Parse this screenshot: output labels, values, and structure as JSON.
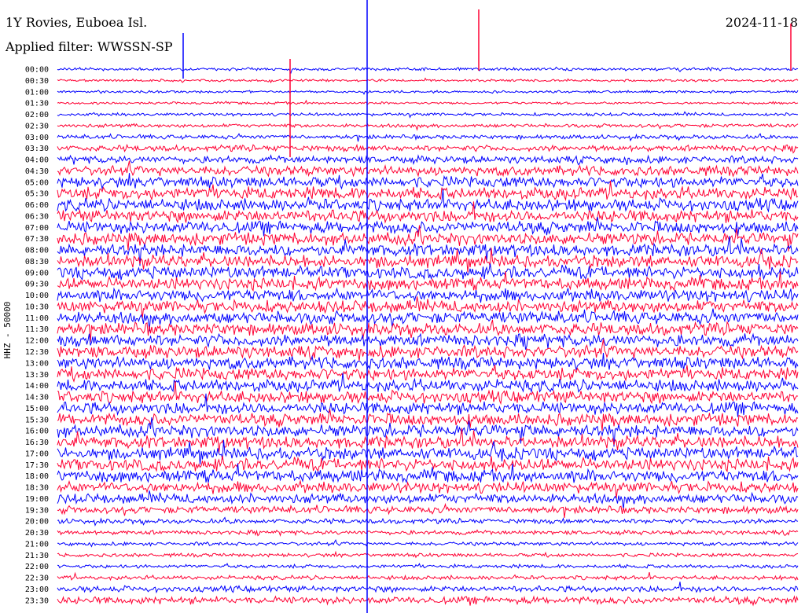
{
  "header": {
    "station": "1Y Rovies, Euboea Isl.",
    "date": "2024-11-18",
    "filter": "Applied filter: WWSSN-SP"
  },
  "chart_data": {
    "type": "line",
    "title": "1Y Rovies, Euboea Isl.",
    "ylabel": "HHZ - 50000",
    "row_labels": [
      "00:00",
      "00:30",
      "01:00",
      "01:30",
      "02:00",
      "02:30",
      "03:00",
      "03:30",
      "04:00",
      "04:30",
      "05:00",
      "05:30",
      "06:00",
      "06:30",
      "07:00",
      "07:30",
      "08:00",
      "08:30",
      "09:00",
      "09:30",
      "10:00",
      "10:30",
      "11:00",
      "11:30",
      "12:00",
      "12:30",
      "13:00",
      "13:30",
      "14:00",
      "14:30",
      "15:00",
      "15:30",
      "16:00",
      "16:30",
      "17:00",
      "17:30",
      "18:00",
      "18:30",
      "19:00",
      "19:30",
      "20:00",
      "20:30",
      "21:00",
      "21:30",
      "22:00",
      "22:30",
      "23:00",
      "23:30"
    ],
    "trace_colors": [
      "#0000ff",
      "#ff0033"
    ],
    "relative_amplitude": [
      0.25,
      0.2,
      0.2,
      0.2,
      0.25,
      0.3,
      0.35,
      0.5,
      0.6,
      0.8,
      0.9,
      1.0,
      1.0,
      1.0,
      1.0,
      1.0,
      1.0,
      1.0,
      1.0,
      1.0,
      1.0,
      1.0,
      1.0,
      1.0,
      1.0,
      1.0,
      1.0,
      1.0,
      1.0,
      1.0,
      1.0,
      1.0,
      1.0,
      1.0,
      1.0,
      1.0,
      1.0,
      0.9,
      0.8,
      0.6,
      0.4,
      0.35,
      0.3,
      0.3,
      0.3,
      0.35,
      0.5,
      0.6
    ],
    "grid": false
  }
}
